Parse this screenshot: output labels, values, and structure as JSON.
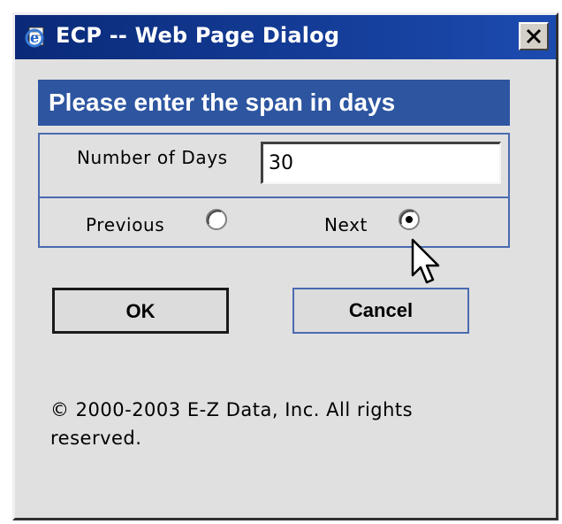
{
  "window": {
    "title": "ECP -- Web Page Dialog",
    "title_bar_color": "#0a2a78",
    "close_label": "close"
  },
  "dialog": {
    "header": "Please enter the span in days",
    "header_color": "#2d55a0",
    "days_label": "Number of Days",
    "days_value": "30",
    "radio_previous_label": "Previous",
    "radio_next_label": "Next",
    "selected_direction": "Next",
    "ok_label": "OK",
    "cancel_label": "Cancel",
    "copyright": "© 2000-2003 E-Z Data, Inc. All rights reserved."
  },
  "icons": {
    "title_icon": "ie-page-icon",
    "close_icon": "close-icon",
    "cursor": "mouse-pointer-icon"
  }
}
